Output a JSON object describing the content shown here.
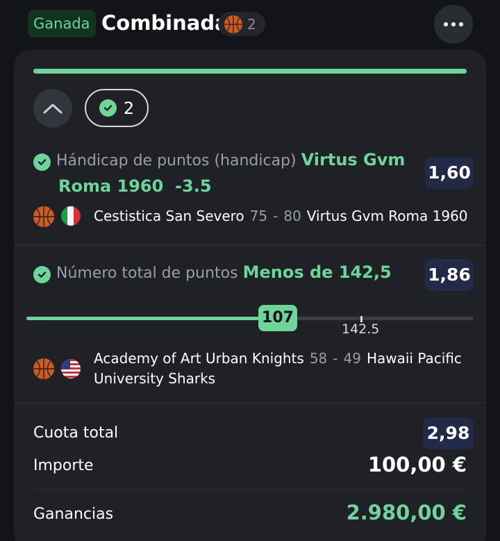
{
  "header": {
    "status_badge": "Ganada",
    "title": "Combinada",
    "sport_count": "2"
  },
  "summary": {
    "selection_count": "2"
  },
  "bets": [
    {
      "market": "Hándicap de puntos (handicap)",
      "pick_line1": "Virtus Gvm",
      "pick_line2": "Roma 1960  -3.5",
      "odds": "1,60",
      "home_team": "Cestistica San Severo",
      "home_score": "75",
      "separator": "-",
      "away_score": "80",
      "away_team": "Virtus Gvm Roma 1960",
      "flag": "italy-flag"
    },
    {
      "market": "Número total de puntos",
      "pick": "Menos de 142,5",
      "odds": "1,86",
      "progress_current": "107",
      "progress_line": "142.5",
      "progress_value": 107,
      "progress_max": 142.5,
      "home_team": "Academy of Art Urban Knights",
      "home_score": "58",
      "separator": "-",
      "away_score": "49",
      "away_team_line1": "Hawaii Pacific",
      "away_team_line2": "University Sharks",
      "flag": "usa-flag"
    }
  ],
  "totals": {
    "total_odds_label": "Cuota total",
    "total_odds": "2,98",
    "stake_label": "Importe",
    "stake": "100,00 €",
    "winnings_label": "Ganancias",
    "winnings": "2.980,00 €"
  },
  "colors": {
    "accent_green": "#6fd49a",
    "background": "#131419",
    "card": "#1f2127",
    "odds_bg": "#232a48"
  },
  "icons": [
    "basketball-icon",
    "check-icon",
    "chevron-up-icon",
    "more-icon",
    "italy-flag",
    "usa-flag"
  ]
}
